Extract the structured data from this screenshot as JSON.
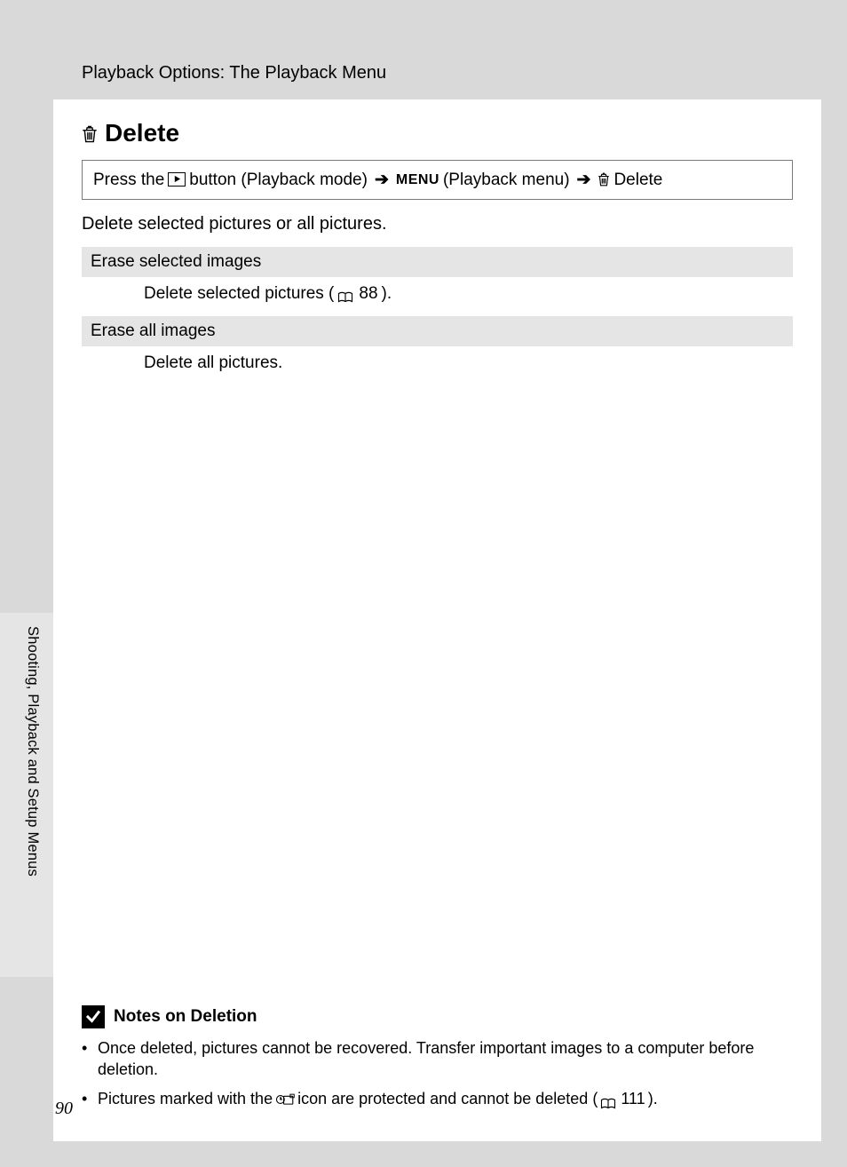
{
  "header": "Playback Options: The Playback Menu",
  "title": "Delete",
  "nav": {
    "press": "Press the",
    "playbackMode": "button (Playback mode)",
    "menu": "MENU",
    "playbackMenu": "(Playback menu)",
    "delete": "Delete"
  },
  "description": "Delete selected pictures or all pictures.",
  "options": [
    {
      "head": "Erase selected images",
      "bodyPre": "Delete selected pictures (",
      "ref": "88",
      "bodyPost": ")."
    },
    {
      "head": "Erase all images",
      "bodyPre": "Delete all pictures.",
      "ref": "",
      "bodyPost": ""
    }
  ],
  "sideText": "Shooting, Playback and Setup Menus",
  "notes": {
    "title": "Notes on Deletion",
    "items": [
      {
        "pre": "Once deleted, pictures cannot be recovered. Transfer important images to a computer before deletion.",
        "ref": "",
        "post": ""
      },
      {
        "pre": "Pictures marked with the",
        "mid": "icon are protected and cannot be deleted (",
        "ref": "111",
        "post": ")."
      }
    ]
  },
  "pageNumber": "90"
}
